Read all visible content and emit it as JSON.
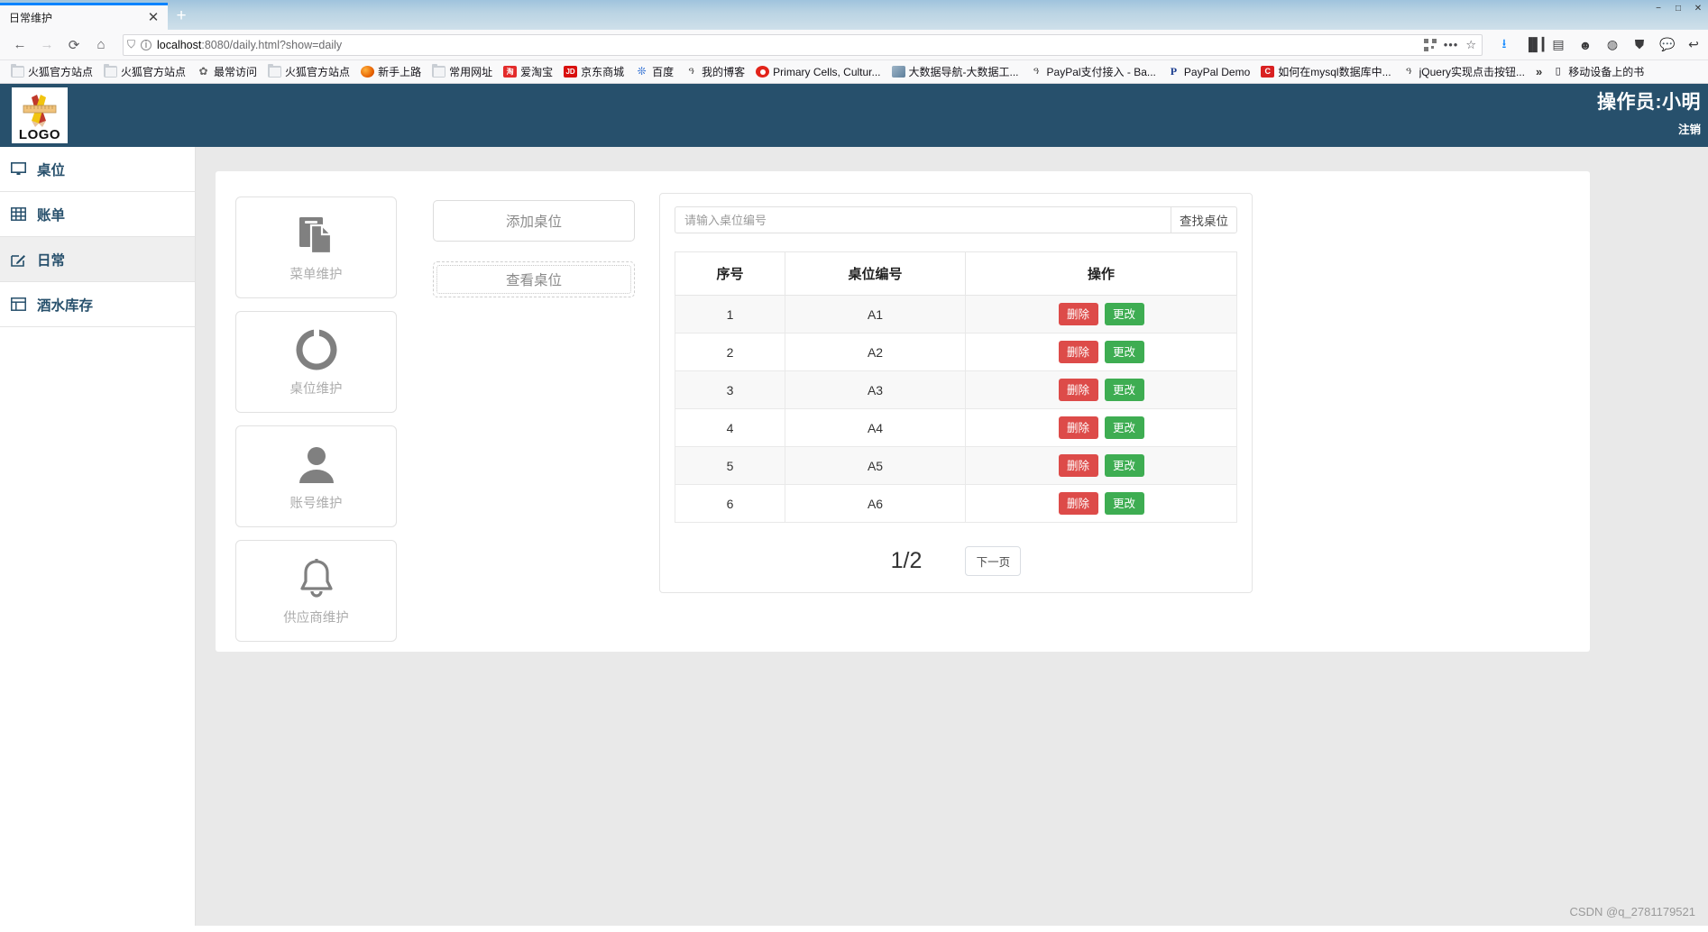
{
  "browser": {
    "tab": {
      "title": "日常维护",
      "close_label": "✕"
    },
    "newtab_label": "+",
    "window_controls": [
      "−",
      "□",
      "✕"
    ],
    "nav": {
      "back": "←",
      "forward": "→",
      "reload": "⟳",
      "home": "⌂"
    },
    "url": {
      "prefix": "localhost",
      "rest": ":8080/daily.html?show=daily",
      "full": "localhost:8080/daily.html?show=daily"
    },
    "url_icons": {
      "shield": "shield-icon",
      "info": "i",
      "qr": "qr-icon",
      "dots": "•••",
      "star": "☆"
    },
    "toolbar_icons": [
      "download-icon",
      "library-icon",
      "sidebar-icon",
      "account-icon",
      "sync-icon",
      "container-icon",
      "chat-icon",
      "share-icon"
    ],
    "bookmarks": [
      {
        "label": "火狐官方站点",
        "icon": "folder-icon"
      },
      {
        "label": "火狐官方站点",
        "icon": "folder-icon"
      },
      {
        "label": "最常访问",
        "icon": "gear-icon"
      },
      {
        "label": "火狐官方站点",
        "icon": "folder-icon"
      },
      {
        "label": "新手上路",
        "icon": "firefox-icon"
      },
      {
        "label": "常用网址",
        "icon": "folder-icon"
      },
      {
        "label": "爱淘宝",
        "icon": "taobao-icon"
      },
      {
        "label": "京东商城",
        "icon": "jd-icon"
      },
      {
        "label": "百度",
        "icon": "baidu-icon"
      },
      {
        "label": "我的博客",
        "icon": "blog-icon"
      },
      {
        "label": "Primary Cells, Cultur...",
        "icon": "red-circle-icon"
      },
      {
        "label": "大数据导航-大数据工...",
        "icon": "bigdata-icon"
      },
      {
        "label": "PayPal支付接入 - Ba...",
        "icon": "blog-icon"
      },
      {
        "label": "PayPal Demo",
        "icon": "paypal-icon"
      },
      {
        "label": "如何在mysql数据库中...",
        "icon": "csdn-icon"
      },
      {
        "label": "jQuery实现点击按钮...",
        "icon": "blog-icon"
      }
    ],
    "bookmarks_overflow": "»",
    "mobile_bookmarks": "移动设备上的书"
  },
  "app": {
    "logo_text": "LOGO",
    "operator_name": "操作员:小明",
    "logout_label": "注销"
  },
  "sidebar": {
    "items": [
      {
        "label": "桌位",
        "icon": "monitor-icon",
        "active": false
      },
      {
        "label": "账单",
        "icon": "grid-icon",
        "active": false
      },
      {
        "label": "日常",
        "icon": "edit-icon",
        "active": true
      },
      {
        "label": "酒水库存",
        "icon": "database-icon",
        "active": false
      }
    ]
  },
  "cards": [
    {
      "label": "菜单维护",
      "icon": "copy-icon"
    },
    {
      "label": "桌位维护",
      "icon": "circle-notch-icon"
    },
    {
      "label": "账号维护",
      "icon": "user-icon"
    },
    {
      "label": "供应商维护",
      "icon": "bell-icon"
    }
  ],
  "actions": {
    "add_table_label": "添加桌位",
    "view_table_label": "查看桌位"
  },
  "search": {
    "placeholder": "请输入桌位编号",
    "value": "",
    "button_label": "查找桌位"
  },
  "table": {
    "headers": [
      "序号",
      "桌位编号",
      "操作"
    ],
    "delete_label": "删除",
    "edit_label": "更改",
    "rows": [
      {
        "index": "1",
        "code": "A1"
      },
      {
        "index": "2",
        "code": "A2"
      },
      {
        "index": "3",
        "code": "A3"
      },
      {
        "index": "4",
        "code": "A4"
      },
      {
        "index": "5",
        "code": "A5"
      },
      {
        "index": "6",
        "code": "A6"
      }
    ]
  },
  "pagination": {
    "label": "1/2",
    "next_label": "下一页"
  },
  "watermark": "CSDN @q_2781179521",
  "colors": {
    "header_bg": "#27506c",
    "delete_btn": "#dd4b49",
    "edit_btn": "#3ead52",
    "accent": "#27506c"
  }
}
